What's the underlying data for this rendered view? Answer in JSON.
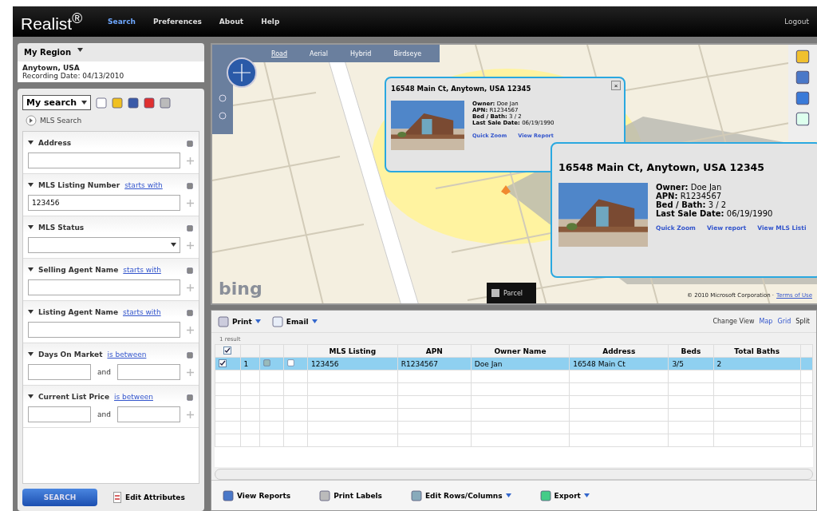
{
  "app": {
    "logo": "Realist$^{®}$",
    "nav": [
      {
        "label": "Search",
        "selected": true
      },
      {
        "label": "Preferences",
        "selected": false
      },
      {
        "label": "About",
        "selected": false
      },
      {
        "label": "Help",
        "selected": false
      }
    ],
    "logout": "Logout"
  },
  "region": {
    "title": "My Region",
    "name": "Anytown, USA",
    "recording": "Recording Date: 04/13/2010"
  },
  "search": {
    "saved": "My search",
    "mls": "MLS Search",
    "criteria": [
      {
        "kind": "text",
        "label": "Address"
      },
      {
        "kind": "text",
        "label": "MLS Listing Number",
        "operator": "starts with",
        "value": "123456"
      },
      {
        "kind": "select",
        "label": "MLS Status"
      },
      {
        "kind": "text",
        "label": "Selling Agent Name",
        "operator": "starts with"
      },
      {
        "kind": "text",
        "label": "Listing Agent Name",
        "operator": "starts with"
      },
      {
        "kind": "range",
        "label": "Days On Market",
        "operator": "is between",
        "and": "and"
      },
      {
        "kind": "range",
        "label": "Current List Price",
        "operator": "is between",
        "and": "and"
      }
    ],
    "button": "SEARCH",
    "edit": "Edit Attributes"
  },
  "map": {
    "types": [
      {
        "label": "Road",
        "selected": true
      },
      {
        "label": "Aerial",
        "selected": false
      },
      {
        "label": "Hybrid",
        "selected": false
      },
      {
        "label": "Birdseye",
        "selected": false
      }
    ],
    "brand": "bing",
    "parcel": "Parcel",
    "copyright": "© 2010 Microsoft Corporation ·",
    "terms": "Terms of Use",
    "popups": [
      {
        "title": "16548 Main Ct, Anytown, USA 12345",
        "lines": [
          [
            "Owner:",
            "Doe Jan"
          ],
          [
            "APN:",
            "R1234567"
          ],
          [
            "Bed / Bath:",
            "3 / 2"
          ],
          [
            "Last Sale Date:",
            "06/19/1990"
          ]
        ],
        "links": [
          "Quick Zoom",
          "View Report"
        ],
        "close": "×"
      },
      {
        "title": "16548 Main Ct, Anytown, USA 12345",
        "lines": [
          [
            "Owner:",
            "Doe Jan"
          ],
          [
            "APN:",
            "R1234567"
          ],
          [
            "Bed / Bath:",
            "3 / 2"
          ],
          [
            "Last Sale Date:",
            "06/19/1990"
          ]
        ],
        "links": [
          "Quick Zoom",
          "View report",
          "View MLS Listi"
        ]
      }
    ]
  },
  "results": {
    "print": "Print",
    "email": "Email",
    "change_view": "Change View",
    "views": [
      {
        "label": "Map",
        "selected": false
      },
      {
        "label": "Grid",
        "selected": false
      },
      {
        "label": "Split",
        "selected": true
      }
    ],
    "count": "1 result",
    "header_checked": true,
    "columns": [
      "MLS Listing",
      "APN",
      "Owner Name",
      "Address",
      "Beds",
      "Total Baths"
    ],
    "rows": [
      {
        "selected": true,
        "checked": true,
        "index": "1",
        "cells": [
          "123456",
          "R1234567",
          "Doe Jan",
          "16548 Main Ct",
          "3/5",
          "2"
        ]
      }
    ],
    "actions": [
      "View Reports",
      "Print Labels",
      "Edit Rows/Columns",
      "Export"
    ]
  }
}
